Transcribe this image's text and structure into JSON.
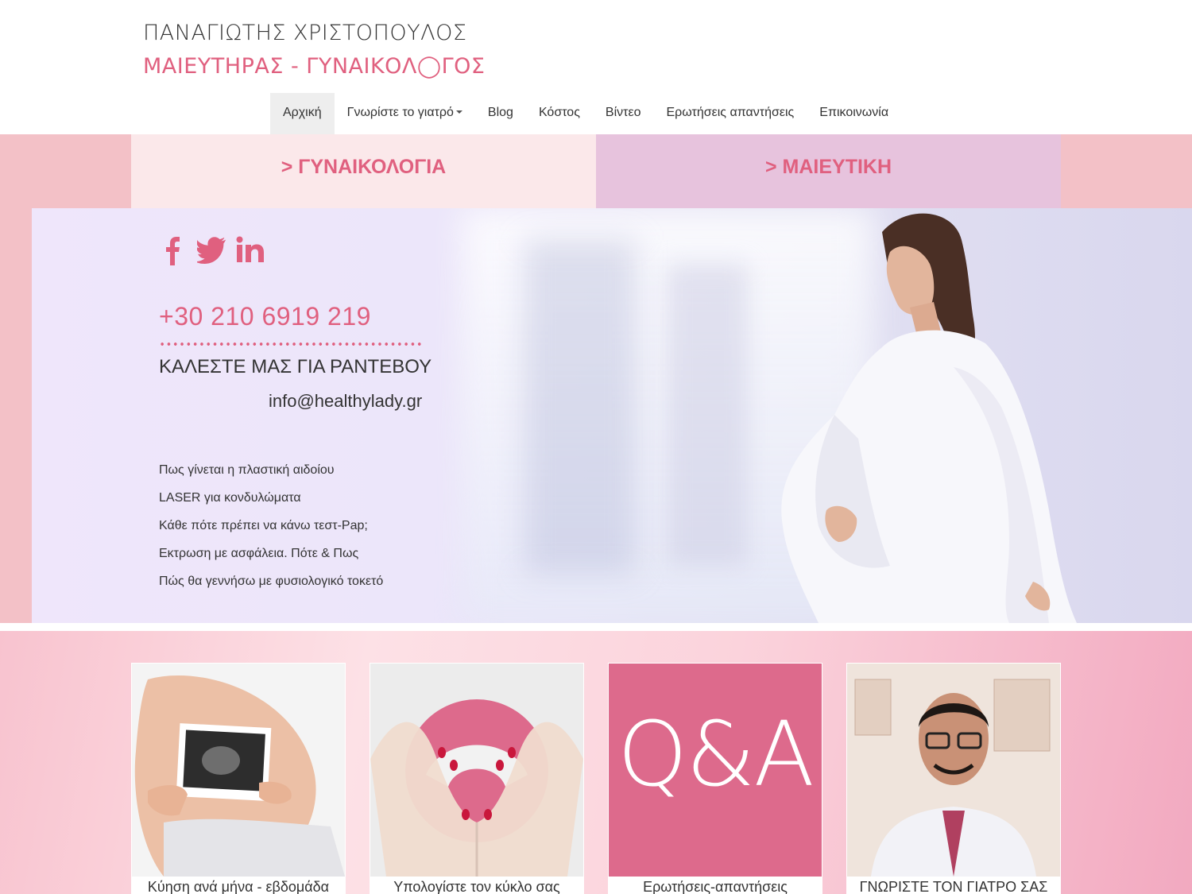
{
  "logo": {
    "name": "ΠΑΝΑΓΙΩΤΗΣ ΧΡΙΣΤΟΠΟΥΛΟΣ",
    "title": "ΜΑΙΕΥΤΗΡΑΣ - ΓΥΝΑΙΚΟΛ◯ΓΟΣ"
  },
  "nav": {
    "items": [
      {
        "label": "Αρχική"
      },
      {
        "label": "Γνωρίστε το γιατρό"
      },
      {
        "label": "Blog"
      },
      {
        "label": "Κόστος"
      },
      {
        "label": "Βίντεο"
      },
      {
        "label": "Ερωτήσεις απαντήσεις"
      },
      {
        "label": "Επικοινωνία"
      }
    ]
  },
  "categories": {
    "gynecology": "> ΓΥΝΑΙΚΟΛΟΓΙΑ",
    "obstetrics": "> ΜΑΙΕΥΤΙΚΗ"
  },
  "hero": {
    "social_icons": [
      "facebook-icon",
      "twitter-icon",
      "linkedin-icon"
    ],
    "phone": "+30 210 6919 219",
    "call_text": "ΚΑΛΕΣΤΕ ΜΑΣ ΓΙΑ ΡΑΝΤΕΒΟΥ",
    "email": "info@healthylady.gr",
    "links": [
      "Πως γίνεται η πλαστική αιδοίου",
      "LASER για κονδυλώματα",
      "Κάθε πότε πρέπει να κάνω τεστ-Pap;",
      "Εκτρωση με ασφάλεια. Πότε & Πως",
      "Πώς θα γεννήσω με φυσιολογικό τοκετό"
    ]
  },
  "cards": [
    {
      "caption": "Κύηση ανά μήνα - εβδομάδα"
    },
    {
      "caption": "Υπολογίστε τον κύκλο σας"
    },
    {
      "caption": "Ερωτήσεις-απαντήσεις",
      "image_text": "Q&A"
    },
    {
      "caption": "ΓΝΩΡΙΣΤΕ ΤΟΝ ΓΙΑΤΡΟ ΣΑΣ"
    }
  ],
  "colors": {
    "accent": "#e0607f",
    "pink_band": "#f3c1c7",
    "gynecology_bg": "#fbe8ea",
    "obstetrics_bg": "#e7c3dd",
    "qa_bg": "#dd6a8c"
  }
}
